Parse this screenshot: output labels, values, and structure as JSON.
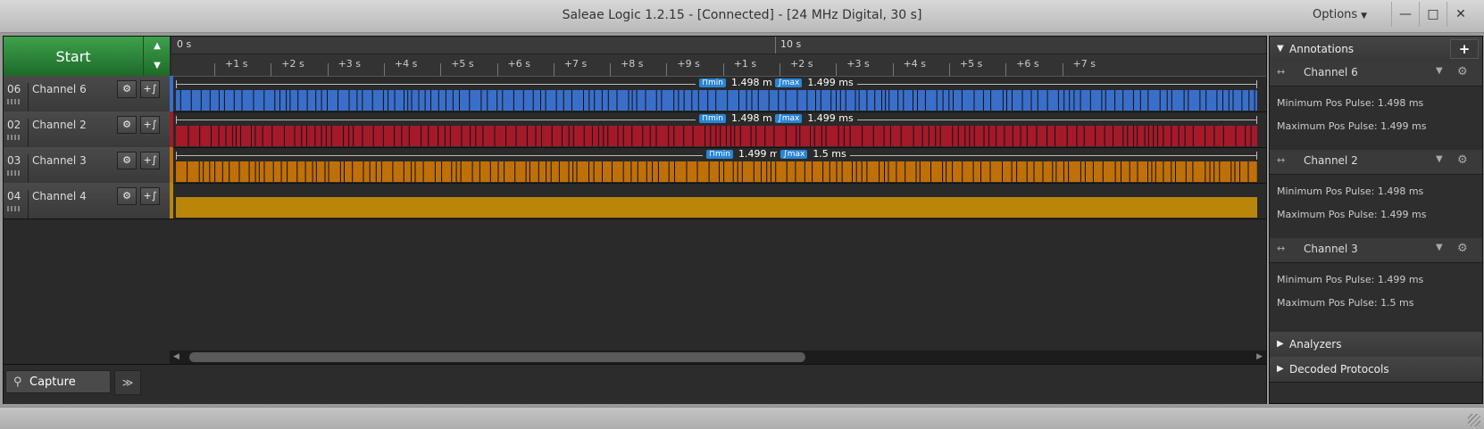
{
  "window": {
    "title": "Saleae Logic 1.2.15 - [Connected] - [24 MHz Digital, 30 s]",
    "options_label": "Options",
    "minimize": "—",
    "maximize": "□",
    "close": "✕"
  },
  "toolbar": {
    "start_label": "Start",
    "up_arrow": "▲",
    "down_arrow": "▼"
  },
  "timeline": {
    "top_marks": [
      "0 s",
      "10 s"
    ],
    "ticks": [
      "+1 s",
      "+2 s",
      "+3 s",
      "+4 s",
      "+5 s",
      "+6 s",
      "+7 s",
      "+8 s",
      "+9 s",
      "+1 s",
      "+2 s",
      "+3 s",
      "+4 s",
      "+5 s",
      "+6 s",
      "+7 s"
    ]
  },
  "channels": [
    {
      "num": "06",
      "name": "Channel 6",
      "color": "#3a6fc9",
      "min_tag": "⊓min",
      "min": "1.498 ms",
      "max_tag": "∫max",
      "max": "1.499 ms"
    },
    {
      "num": "02",
      "name": "Channel 2",
      "color": "#a41a2a",
      "min_tag": "⊓min",
      "min": "1.498 ms",
      "max_tag": "∫max",
      "max": "1.499 ms"
    },
    {
      "num": "03",
      "name": "Channel 3",
      "color": "#c07008",
      "min_tag": "⊓min",
      "min": "1.499 ms",
      "max_tag": "∫max",
      "max": "1.5 ms"
    },
    {
      "num": "04",
      "name": "Channel 4",
      "color": "#b9860a"
    }
  ],
  "channel_buttons": {
    "gear": "⚙",
    "add": "+∫"
  },
  "bottom": {
    "capture_tab": "Capture",
    "capture_icon": "⚲",
    "more": "≫"
  },
  "sidebar": {
    "annotations_title": "Annotations",
    "add_label": "+",
    "annotations": [
      {
        "channel": "Channel 6",
        "min_text": "Minimum Pos Pulse: 1.498 ms",
        "max_text": "Maximum Pos Pulse: 1.499 ms"
      },
      {
        "channel": "Channel 2",
        "min_text": "Minimum Pos Pulse: 1.498 ms",
        "max_text": "Maximum Pos Pulse: 1.499 ms"
      },
      {
        "channel": "Channel 3",
        "min_text": "Minimum Pos Pulse: 1.499 ms",
        "max_text": "Maximum Pos Pulse: 1.5 ms"
      }
    ],
    "analyzers_title": "Analyzers",
    "decoded_title": "Decoded Protocols"
  },
  "colors": {
    "accent_green": "#2f8a3c",
    "measure_tag": "#2a84d6"
  }
}
